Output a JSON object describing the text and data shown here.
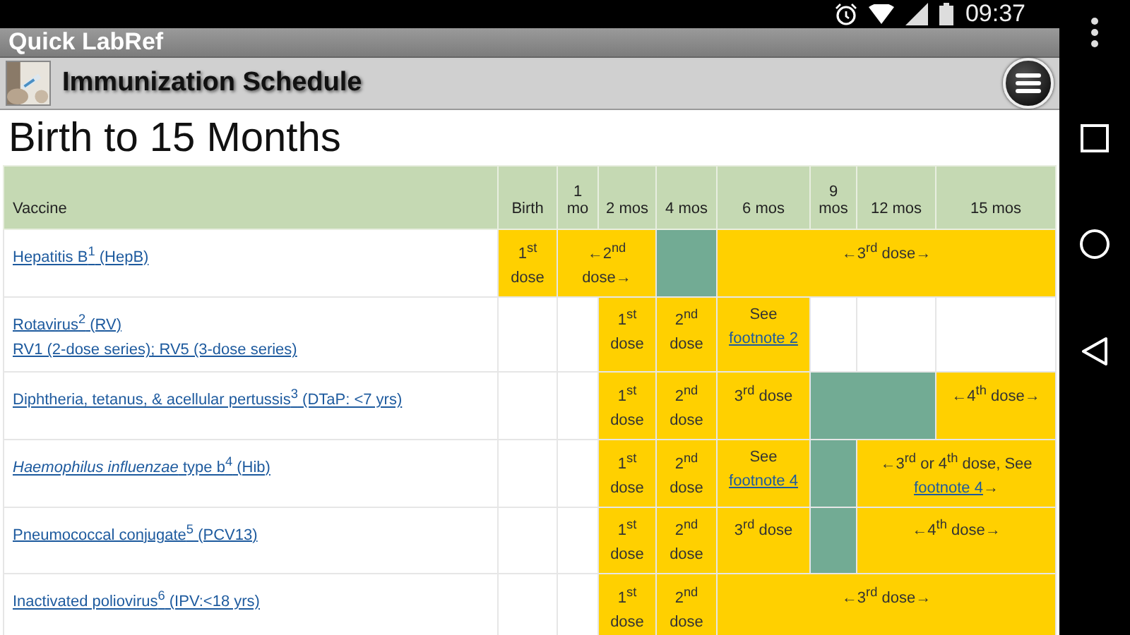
{
  "status_bar": {
    "time": "09:37"
  },
  "app_bar": {
    "title": "Quick LabRef"
  },
  "header": {
    "title": "Immunization Schedule"
  },
  "page_title": "Birth to 15 Months",
  "table": {
    "columns": [
      {
        "label": "Vaccine"
      },
      {
        "label": "Birth"
      },
      {
        "label": "1 mo"
      },
      {
        "label": "2 mos"
      },
      {
        "label": "4 mos"
      },
      {
        "label": "6 mos"
      },
      {
        "label": "9 mos"
      },
      {
        "label": "12 mos"
      },
      {
        "label": "15 mos"
      }
    ],
    "rows": [
      {
        "cells": [
          {
            "kind": "vaccine",
            "lines": [
              "Hepatitis B$^{1}$ (HepB)"
            ]
          },
          {
            "kind": "dose",
            "text": "1$^{st}$ dose"
          },
          {
            "kind": "dose",
            "text": "←2$^{nd}$ dose→",
            "colspan": 2
          },
          {
            "kind": "gap"
          },
          {
            "kind": "dose",
            "text": "←3$^{rd}$ dose→",
            "colspan": 4
          }
        ]
      },
      {
        "cells": [
          {
            "kind": "vaccine",
            "lines": [
              "Rotavirus$^{2}$ (RV)",
              "RV1 (2-dose series); RV5 (3-dose series)"
            ]
          },
          {
            "kind": "empty"
          },
          {
            "kind": "empty"
          },
          {
            "kind": "dose",
            "text": "1$^{st}$ dose"
          },
          {
            "kind": "dose",
            "text": "2$^{nd}$ dose"
          },
          {
            "kind": "dose",
            "text": "See",
            "link": "footnote 2"
          },
          {
            "kind": "empty"
          },
          {
            "kind": "empty"
          },
          {
            "kind": "empty"
          }
        ]
      },
      {
        "cells": [
          {
            "kind": "vaccine",
            "lines": [
              "Diphtheria, tetanus, & acellular pertussis$^{3}$ (DTaP: <7 yrs)"
            ]
          },
          {
            "kind": "empty"
          },
          {
            "kind": "empty"
          },
          {
            "kind": "dose",
            "text": "1$^{st}$ dose"
          },
          {
            "kind": "dose",
            "text": "2$^{nd}$ dose"
          },
          {
            "kind": "dose",
            "text": "3$^{rd}$ dose"
          },
          {
            "kind": "gap",
            "colspan": 2
          },
          {
            "kind": "dose",
            "text": "←4$^{th}$ dose→"
          }
        ]
      },
      {
        "cells": [
          {
            "kind": "vaccine",
            "lines": [
              "*Haemophilus influenzae* type b$^{4}$ (Hib)"
            ]
          },
          {
            "kind": "empty"
          },
          {
            "kind": "empty"
          },
          {
            "kind": "dose",
            "text": "1$^{st}$ dose"
          },
          {
            "kind": "dose",
            "text": "2$^{nd}$ dose"
          },
          {
            "kind": "dose",
            "text": "See",
            "link": "footnote 4"
          },
          {
            "kind": "gap"
          },
          {
            "kind": "dose",
            "text": "←3$^{rd}$ or 4$^{th}$ dose, See",
            "link": "footnote 4",
            "tail": "→",
            "colspan": 2
          }
        ]
      },
      {
        "cells": [
          {
            "kind": "vaccine",
            "lines": [
              "Pneumococcal conjugate$^{5}$ (PCV13)"
            ]
          },
          {
            "kind": "empty"
          },
          {
            "kind": "empty"
          },
          {
            "kind": "dose",
            "text": "1$^{st}$ dose"
          },
          {
            "kind": "dose",
            "text": "2$^{nd}$ dose"
          },
          {
            "kind": "dose",
            "text": "3$^{rd}$ dose"
          },
          {
            "kind": "gap"
          },
          {
            "kind": "dose",
            "text": "←4$^{th}$ dose→",
            "colspan": 2
          }
        ]
      },
      {
        "cells": [
          {
            "kind": "vaccine",
            "lines": [
              "Inactivated poliovirus$^{6}$ (IPV:<18 yrs)"
            ]
          },
          {
            "kind": "empty"
          },
          {
            "kind": "empty"
          },
          {
            "kind": "dose",
            "text": "1$^{st}$ dose"
          },
          {
            "kind": "dose",
            "text": "2$^{nd}$ dose"
          },
          {
            "kind": "dose",
            "text": "←3$^{rd}$ dose→",
            "colspan": 4
          }
        ]
      }
    ]
  }
}
